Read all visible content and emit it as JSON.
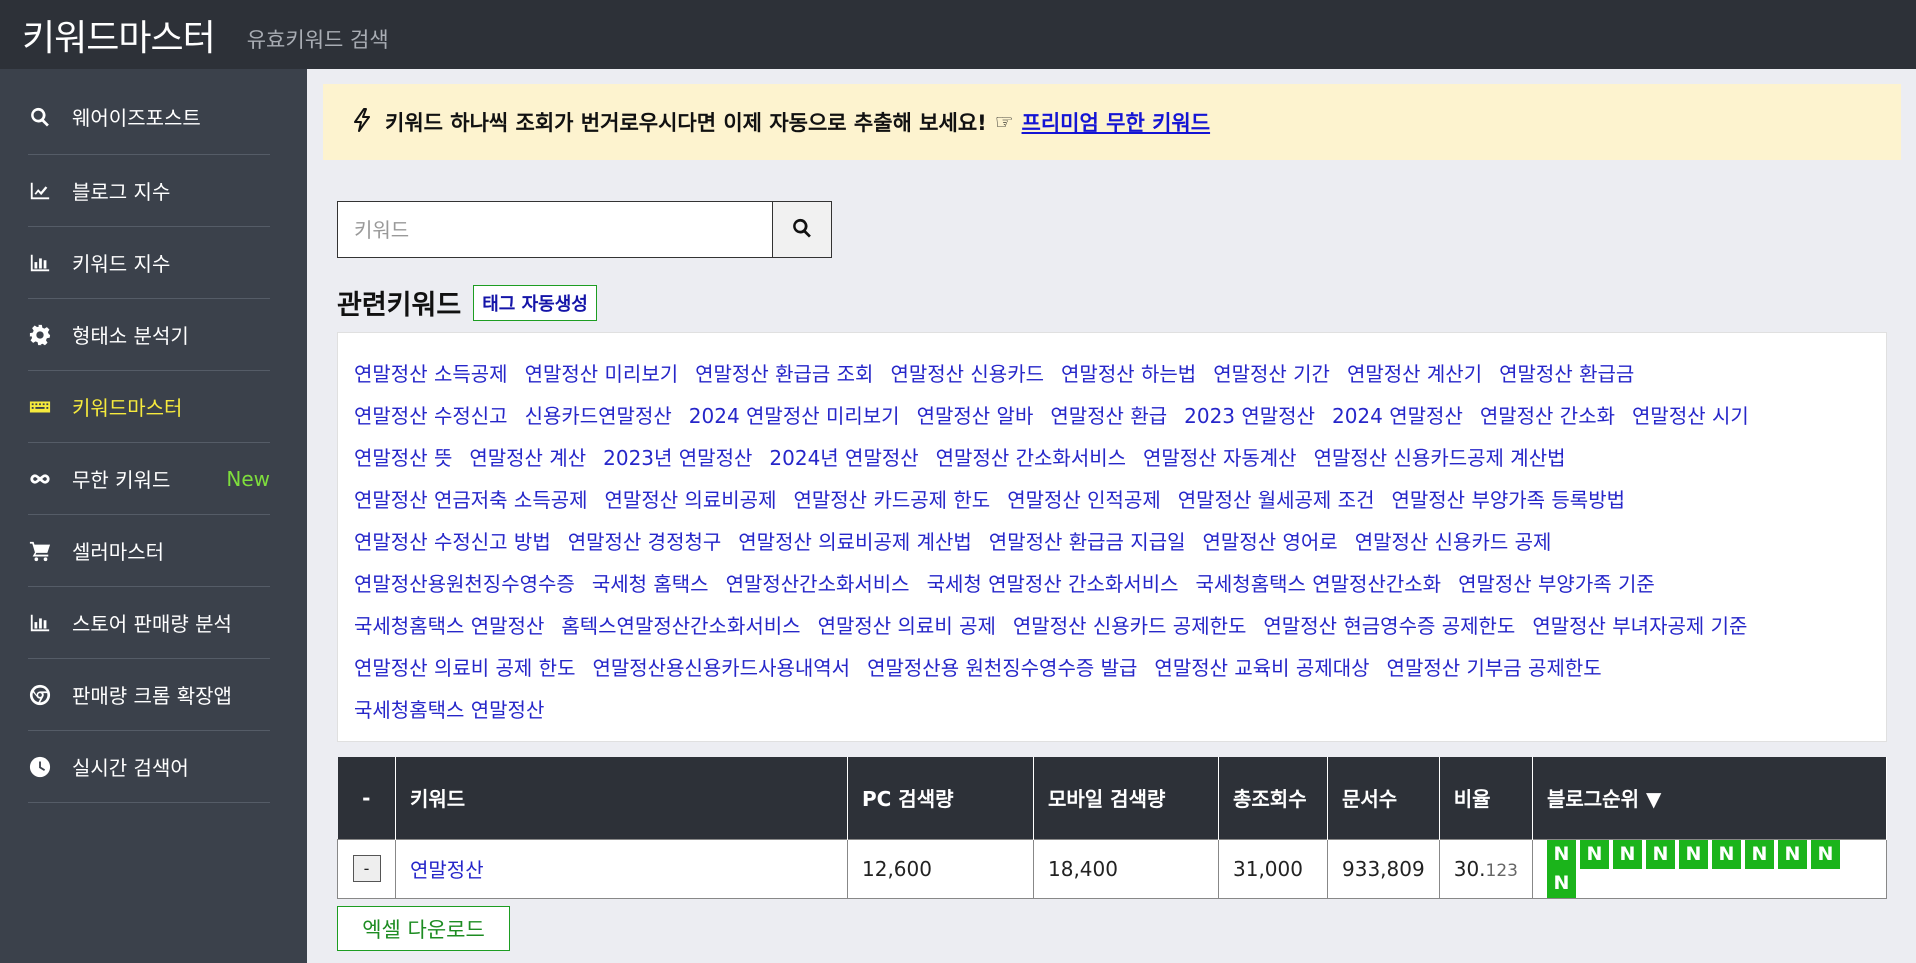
{
  "header": {
    "title": "키워드마스터",
    "subtitle": "유효키워드 검색"
  },
  "sidebar": {
    "items": [
      {
        "label": "웨어이즈포스트",
        "icon": "search-icon"
      },
      {
        "label": "블로그 지수",
        "icon": "line-chart-icon"
      },
      {
        "label": "키워드 지수",
        "icon": "bar-chart-icon"
      },
      {
        "label": "형태소 분석기",
        "icon": "gear-icon"
      },
      {
        "label": "키워드마스터",
        "icon": "keyboard-icon",
        "active": true
      },
      {
        "label": "무한 키워드",
        "icon": "infinity-icon",
        "badge": "New"
      },
      {
        "label": "셀러마스터",
        "icon": "cart-icon"
      },
      {
        "label": "스토어 판매량 분석",
        "icon": "bar-chart-icon"
      },
      {
        "label": "판매량 크롬 확장앱",
        "icon": "chrome-icon"
      },
      {
        "label": "실시간 검색어",
        "icon": "clock-icon"
      }
    ]
  },
  "notice": {
    "text": "키워드 하나씩 조회가 번거로우시다면 이제 자동으로 추출해 보세요!",
    "pointer": "☞",
    "link": "프리미엄 무한 키워드"
  },
  "search": {
    "placeholder": "키워드"
  },
  "related": {
    "title": "관련키워드",
    "tag_button": "태그 자동생성",
    "rows": [
      [
        "연말정산 소득공제",
        "연말정산 미리보기",
        "연말정산 환급금 조회",
        "연말정산 신용카드",
        "연말정산 하는법",
        "연말정산 기간",
        "연말정산 계산기",
        "연말정산 환급금"
      ],
      [
        "연말정산 수정신고",
        "신용카드연말정산",
        "2024 연말정산 미리보기",
        "연말정산 알바",
        "연말정산 환급",
        "2023 연말정산",
        "2024 연말정산",
        "연말정산 간소화",
        "연말정산 시기"
      ],
      [
        "연말정산 뜻",
        "연말정산 계산",
        "2023년 연말정산",
        "2024년 연말정산",
        "연말정산 간소화서비스",
        "연말정산 자동계산",
        "연말정산 신용카드공제 계산법"
      ],
      [
        "연말정산 연금저축 소득공제",
        "연말정산 의료비공제",
        "연말정산 카드공제 한도",
        "연말정산 인적공제",
        "연말정산 월세공제 조건",
        "연말정산 부양가족 등록방법"
      ],
      [
        "연말정산 수정신고 방법",
        "연말정산 경정청구",
        "연말정산 의료비공제 계산법",
        "연말정산 환급금 지급일",
        "연말정산 영어로",
        "연말정산 신용카드 공제"
      ],
      [
        "연말정산용원천징수영수증",
        "국세청 홈택스",
        "연말정산간소화서비스",
        "국세청 연말정산 간소화서비스",
        "국세청홈택스 연말정산간소화",
        "연말정산 부양가족 기준"
      ],
      [
        "국세청홈택스 연말정산",
        "홈텍스연말정산간소화서비스",
        "연말정산 의료비 공제",
        "연말정산 신용카드 공제한도",
        "연말정산 현금영수증 공제한도",
        "연말정산 부녀자공제 기준"
      ],
      [
        "연말정산 의료비 공제 한도",
        "연말정산용신용카드사용내역서",
        "연말정산용 원천징수영수증 발급",
        "연말정산 교육비 공제대상",
        "연말정산 기부금 공제한도"
      ],
      [
        "국세청홈택스 연말정산"
      ]
    ]
  },
  "table": {
    "headers": [
      "-",
      "키워드",
      "PC 검색량",
      "모바일 검색량",
      "총조회수",
      "문서수",
      "비율",
      "블로그순위 ▼"
    ],
    "row": {
      "button": "-",
      "keyword": "연말정산",
      "pc": "12,600",
      "mobile": "18,400",
      "total": "31,000",
      "docs": "933,809",
      "ratio_main": "30.",
      "ratio_sub": "123",
      "rank_badges": [
        "N",
        "N",
        "N",
        "N",
        "N",
        "N",
        "N",
        "N",
        "N",
        "N"
      ]
    }
  },
  "excel_button": "엑셀 다운로드",
  "colors": {
    "header_bg": "#2d3138",
    "sidebar_bg": "#3b414b",
    "active": "#f6ea3d",
    "new_badge": "#7ede3c",
    "notice_bg": "#fdf3cf",
    "link": "#2626c9",
    "rank_badge": "#1bb41b"
  }
}
